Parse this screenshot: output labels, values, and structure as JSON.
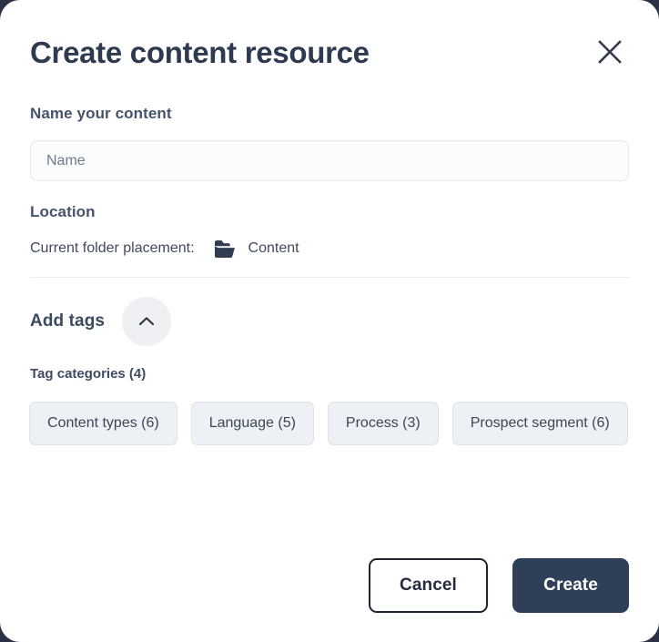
{
  "dialog": {
    "title": "Create content resource",
    "close_icon": "close-x-icon"
  },
  "name_section": {
    "label": "Name your content",
    "input_value": "",
    "input_placeholder": "Name"
  },
  "location_section": {
    "label": "Location",
    "caption": "Current folder placement:",
    "folder_icon": "folder-open-icon",
    "folder_name": "Content"
  },
  "tags_section": {
    "title": "Add tags",
    "collapse_icon": "chevron-up-icon",
    "categories_label": "Tag categories (4)",
    "categories": [
      {
        "label": "Content types (6)"
      },
      {
        "label": "Language (5)"
      },
      {
        "label": "Process (3)"
      },
      {
        "label": "Prospect segment (6)"
      }
    ]
  },
  "footer": {
    "cancel_label": "Cancel",
    "create_label": "Create"
  },
  "colors": {
    "backdrop": "#2c3245",
    "card": "#ffffff",
    "primary_button": "#2e3f57",
    "title_text": "#2e3a4f",
    "chip_background": "#edf0f4",
    "divider": "#eaedf1"
  }
}
